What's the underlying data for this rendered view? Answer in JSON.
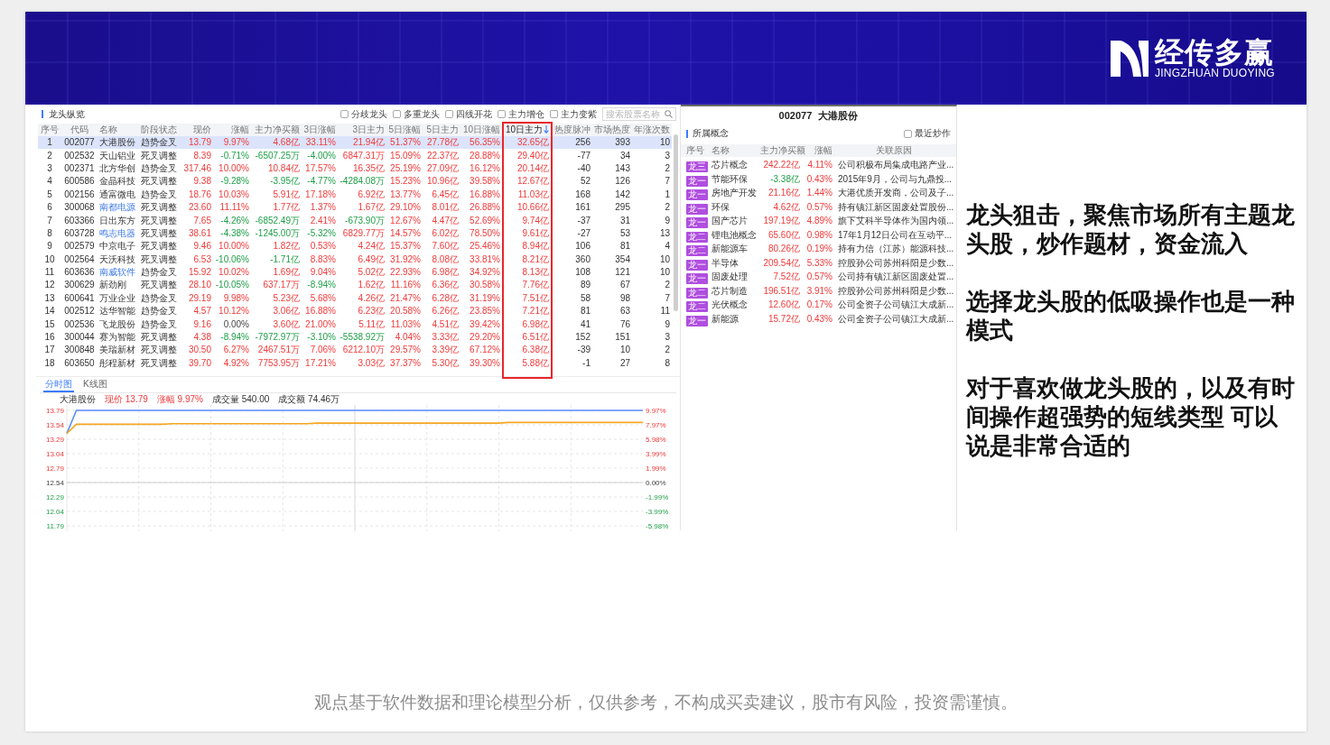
{
  "header": {
    "logo_title": "经传多赢",
    "logo_subtitle": "JINGZHUAN DUOYING"
  },
  "ranking": {
    "title": "龙头纵览",
    "filters": [
      {
        "label": "分歧龙头",
        "checked": false
      },
      {
        "label": "多重龙头",
        "checked": false
      },
      {
        "label": "四线开花",
        "checked": false
      },
      {
        "label": "主力增仓",
        "checked": false
      },
      {
        "label": "主力变紫",
        "checked": false
      }
    ],
    "search": {
      "placeholder": "搜索股票名称"
    },
    "columns": [
      {
        "label": "序号",
        "sorted": false,
        "framed": false
      },
      {
        "label": "代码",
        "sorted": false,
        "framed": false
      },
      {
        "label": "名称",
        "sorted": false,
        "framed": false
      },
      {
        "label": "阶段状态",
        "sorted": false,
        "framed": false
      },
      {
        "label": "现价",
        "sorted": false,
        "framed": false
      },
      {
        "label": "涨幅",
        "sorted": false,
        "framed": false
      },
      {
        "label": "主力净买额",
        "sorted": false,
        "framed": false
      },
      {
        "label": "3日涨幅",
        "sorted": false,
        "framed": false
      },
      {
        "label": "3日主力",
        "sorted": false,
        "framed": false
      },
      {
        "label": "5日涨幅",
        "sorted": false,
        "framed": false
      },
      {
        "label": "5日主力",
        "sorted": false,
        "framed": false
      },
      {
        "label": "10日涨幅",
        "sorted": false,
        "framed": false
      },
      {
        "label": "10日主力",
        "sorted": true,
        "framed": true
      },
      {
        "label": "热度脉冲",
        "sorted": false,
        "framed": false
      },
      {
        "label": "市场热度",
        "sorted": false,
        "framed": false
      },
      {
        "label": "年涨次数",
        "sorted": false,
        "framed": false
      }
    ],
    "rows": [
      {
        "no": "1",
        "code": "002077",
        "name": "大港股份",
        "highlighted": false,
        "stage": "趋势金叉",
        "figures": [
          {
            "text": "13.79",
            "rising": true,
            "falling": false
          },
          {
            "text": "9.97%",
            "rising": true,
            "falling": false
          },
          {
            "text": "4.68亿",
            "rising": true,
            "falling": false
          },
          {
            "text": "33.11%",
            "rising": true,
            "falling": false
          },
          {
            "text": "21.94亿",
            "rising": true,
            "falling": false
          },
          {
            "text": "51.37%",
            "rising": true,
            "falling": false
          },
          {
            "text": "27.78亿",
            "rising": true,
            "falling": false
          },
          {
            "text": "56.35%",
            "rising": true,
            "falling": false
          },
          {
            "text": "32.65亿",
            "rising": true,
            "falling": false
          }
        ],
        "heat_pulse": "256",
        "market_heat": "393",
        "up_count": "10",
        "selected": true
      },
      {
        "no": "2",
        "code": "002532",
        "name": "天山铝业",
        "highlighted": false,
        "stage": "死叉调整",
        "figures": [
          {
            "text": "8.39",
            "rising": true,
            "falling": false
          },
          {
            "text": "-0.71%",
            "rising": false,
            "falling": true
          },
          {
            "text": "-6507.25万",
            "rising": false,
            "falling": true
          },
          {
            "text": "-4.00%",
            "rising": false,
            "falling": true
          },
          {
            "text": "6847.31万",
            "rising": true,
            "falling": false
          },
          {
            "text": "15.09%",
            "rising": true,
            "falling": false
          },
          {
            "text": "22.37亿",
            "rising": true,
            "falling": false
          },
          {
            "text": "28.88%",
            "rising": true,
            "falling": false
          },
          {
            "text": "29.40亿",
            "rising": true,
            "falling": false
          }
        ],
        "heat_pulse": "-77",
        "market_heat": "34",
        "up_count": "3",
        "selected": false
      },
      {
        "no": "3",
        "code": "002371",
        "name": "北方华创",
        "highlighted": false,
        "stage": "趋势金叉",
        "figures": [
          {
            "text": "317.46",
            "rising": true,
            "falling": false
          },
          {
            "text": "10.00%",
            "rising": true,
            "falling": false
          },
          {
            "text": "10.84亿",
            "rising": true,
            "falling": false
          },
          {
            "text": "17.57%",
            "rising": true,
            "falling": false
          },
          {
            "text": "16.35亿",
            "rising": true,
            "falling": false
          },
          {
            "text": "25.19%",
            "rising": true,
            "falling": false
          },
          {
            "text": "27.09亿",
            "rising": true,
            "falling": false
          },
          {
            "text": "16.12%",
            "rising": true,
            "falling": false
          },
          {
            "text": "20.14亿",
            "rising": true,
            "falling": false
          }
        ],
        "heat_pulse": "-40",
        "market_heat": "143",
        "up_count": "2",
        "selected": false
      },
      {
        "no": "4",
        "code": "600586",
        "name": "金晶科技",
        "highlighted": false,
        "stage": "死叉调整",
        "figures": [
          {
            "text": "9.38",
            "rising": true,
            "falling": false
          },
          {
            "text": "-9.28%",
            "rising": false,
            "falling": true
          },
          {
            "text": "-3.95亿",
            "rising": false,
            "falling": true
          },
          {
            "text": "-4.77%",
            "rising": false,
            "falling": true
          },
          {
            "text": "-4284.08万",
            "rising": false,
            "falling": true
          },
          {
            "text": "15.23%",
            "rising": true,
            "falling": false
          },
          {
            "text": "10.96亿",
            "rising": true,
            "falling": false
          },
          {
            "text": "39.58%",
            "rising": true,
            "falling": false
          },
          {
            "text": "12.67亿",
            "rising": true,
            "falling": false
          }
        ],
        "heat_pulse": "52",
        "market_heat": "126",
        "up_count": "7",
        "selected": false
      },
      {
        "no": "5",
        "code": "002156",
        "name": "通富微电",
        "highlighted": false,
        "stage": "趋势金叉",
        "figures": [
          {
            "text": "18.76",
            "rising": true,
            "falling": false
          },
          {
            "text": "10.03%",
            "rising": true,
            "falling": false
          },
          {
            "text": "5.91亿",
            "rising": true,
            "falling": false
          },
          {
            "text": "17.18%",
            "rising": true,
            "falling": false
          },
          {
            "text": "6.92亿",
            "rising": true,
            "falling": false
          },
          {
            "text": "13.77%",
            "rising": true,
            "falling": false
          },
          {
            "text": "6.45亿",
            "rising": true,
            "falling": false
          },
          {
            "text": "16.88%",
            "rising": true,
            "falling": false
          },
          {
            "text": "11.03亿",
            "rising": true,
            "falling": false
          }
        ],
        "heat_pulse": "168",
        "market_heat": "142",
        "up_count": "1",
        "selected": false
      },
      {
        "no": "6",
        "code": "300068",
        "name": "南都电源",
        "highlighted": true,
        "stage": "死叉调整",
        "figures": [
          {
            "text": "23.60",
            "rising": true,
            "falling": false
          },
          {
            "text": "11.11%",
            "rising": true,
            "falling": false
          },
          {
            "text": "1.77亿",
            "rising": true,
            "falling": false
          },
          {
            "text": "1.37%",
            "rising": true,
            "falling": false
          },
          {
            "text": "1.67亿",
            "rising": true,
            "falling": false
          },
          {
            "text": "29.10%",
            "rising": true,
            "falling": false
          },
          {
            "text": "8.01亿",
            "rising": true,
            "falling": false
          },
          {
            "text": "26.88%",
            "rising": true,
            "falling": false
          },
          {
            "text": "10.66亿",
            "rising": true,
            "falling": false
          }
        ],
        "heat_pulse": "161",
        "market_heat": "295",
        "up_count": "2",
        "selected": false
      },
      {
        "no": "7",
        "code": "603366",
        "name": "日出东方",
        "highlighted": false,
        "stage": "死叉调整",
        "figures": [
          {
            "text": "7.65",
            "rising": true,
            "falling": false
          },
          {
            "text": "-4.26%",
            "rising": false,
            "falling": true
          },
          {
            "text": "-6852.49万",
            "rising": false,
            "falling": true
          },
          {
            "text": "2.41%",
            "rising": true,
            "falling": false
          },
          {
            "text": "-673.90万",
            "rising": false,
            "falling": true
          },
          {
            "text": "12.67%",
            "rising": true,
            "falling": false
          },
          {
            "text": "4.47亿",
            "rising": true,
            "falling": false
          },
          {
            "text": "52.69%",
            "rising": true,
            "falling": false
          },
          {
            "text": "9.74亿",
            "rising": true,
            "falling": false
          }
        ],
        "heat_pulse": "-37",
        "market_heat": "31",
        "up_count": "9",
        "selected": false
      },
      {
        "no": "8",
        "code": "603728",
        "name": "鸣志电器",
        "highlighted": true,
        "stage": "死叉调整",
        "figures": [
          {
            "text": "38.61",
            "rising": true,
            "falling": false
          },
          {
            "text": "-4.38%",
            "rising": false,
            "falling": true
          },
          {
            "text": "-1245.00万",
            "rising": false,
            "falling": true
          },
          {
            "text": "-5.32%",
            "rising": false,
            "falling": true
          },
          {
            "text": "6829.77万",
            "rising": true,
            "falling": false
          },
          {
            "text": "14.57%",
            "rising": true,
            "falling": false
          },
          {
            "text": "6.02亿",
            "rising": true,
            "falling": false
          },
          {
            "text": "78.50%",
            "rising": true,
            "falling": false
          },
          {
            "text": "9.61亿",
            "rising": true,
            "falling": false
          }
        ],
        "heat_pulse": "-27",
        "market_heat": "53",
        "up_count": "13",
        "selected": false
      },
      {
        "no": "9",
        "code": "002579",
        "name": "中京电子",
        "highlighted": false,
        "stage": "死叉调整",
        "figures": [
          {
            "text": "9.46",
            "rising": true,
            "falling": false
          },
          {
            "text": "10.00%",
            "rising": true,
            "falling": false
          },
          {
            "text": "1.82亿",
            "rising": true,
            "falling": false
          },
          {
            "text": "0.53%",
            "rising": true,
            "falling": false
          },
          {
            "text": "4.24亿",
            "rising": true,
            "falling": false
          },
          {
            "text": "15.37%",
            "rising": true,
            "falling": false
          },
          {
            "text": "7.60亿",
            "rising": true,
            "falling": false
          },
          {
            "text": "25.46%",
            "rising": true,
            "falling": false
          },
          {
            "text": "8.94亿",
            "rising": true,
            "falling": false
          }
        ],
        "heat_pulse": "106",
        "market_heat": "81",
        "up_count": "4",
        "selected": false
      },
      {
        "no": "10",
        "code": "002564",
        "name": "天沃科技",
        "highlighted": false,
        "stage": "死叉调整",
        "figures": [
          {
            "text": "6.53",
            "rising": true,
            "falling": false
          },
          {
            "text": "-10.06%",
            "rising": false,
            "falling": true
          },
          {
            "text": "-1.71亿",
            "rising": false,
            "falling": true
          },
          {
            "text": "8.83%",
            "rising": true,
            "falling": false
          },
          {
            "text": "6.49亿",
            "rising": true,
            "falling": false
          },
          {
            "text": "31.92%",
            "rising": true,
            "falling": false
          },
          {
            "text": "8.08亿",
            "rising": true,
            "falling": false
          },
          {
            "text": "33.81%",
            "rising": true,
            "falling": false
          },
          {
            "text": "8.21亿",
            "rising": true,
            "falling": false
          }
        ],
        "heat_pulse": "360",
        "market_heat": "354",
        "up_count": "10",
        "selected": false
      },
      {
        "no": "11",
        "code": "603636",
        "name": "南威软件",
        "highlighted": true,
        "stage": "趋势金叉",
        "figures": [
          {
            "text": "15.92",
            "rising": true,
            "falling": false
          },
          {
            "text": "10.02%",
            "rising": true,
            "falling": false
          },
          {
            "text": "1.69亿",
            "rising": true,
            "falling": false
          },
          {
            "text": "9.04%",
            "rising": true,
            "falling": false
          },
          {
            "text": "5.02亿",
            "rising": true,
            "falling": false
          },
          {
            "text": "22.93%",
            "rising": true,
            "falling": false
          },
          {
            "text": "6.98亿",
            "rising": true,
            "falling": false
          },
          {
            "text": "34.92%",
            "rising": true,
            "falling": false
          },
          {
            "text": "8.13亿",
            "rising": true,
            "falling": false
          }
        ],
        "heat_pulse": "108",
        "market_heat": "121",
        "up_count": "10",
        "selected": false
      },
      {
        "no": "12",
        "code": "300629",
        "name": "新劲刚",
        "highlighted": false,
        "stage": "死叉调整",
        "figures": [
          {
            "text": "28.10",
            "rising": true,
            "falling": false
          },
          {
            "text": "-10.05%",
            "rising": false,
            "falling": true
          },
          {
            "text": "637.17万",
            "rising": true,
            "falling": false
          },
          {
            "text": "-8.94%",
            "rising": false,
            "falling": true
          },
          {
            "text": "1.62亿",
            "rising": true,
            "falling": false
          },
          {
            "text": "11.16%",
            "rising": true,
            "falling": false
          },
          {
            "text": "6.36亿",
            "rising": true,
            "falling": false
          },
          {
            "text": "30.58%",
            "rising": true,
            "falling": false
          },
          {
            "text": "7.76亿",
            "rising": true,
            "falling": false
          }
        ],
        "heat_pulse": "89",
        "market_heat": "67",
        "up_count": "2",
        "selected": false
      },
      {
        "no": "13",
        "code": "600641",
        "name": "万业企业",
        "highlighted": false,
        "stage": "趋势金叉",
        "figures": [
          {
            "text": "29.19",
            "rising": true,
            "falling": false
          },
          {
            "text": "9.98%",
            "rising": true,
            "falling": false
          },
          {
            "text": "5.23亿",
            "rising": true,
            "falling": false
          },
          {
            "text": "5.68%",
            "rising": true,
            "falling": false
          },
          {
            "text": "4.26亿",
            "rising": true,
            "falling": false
          },
          {
            "text": "21.47%",
            "rising": true,
            "falling": false
          },
          {
            "text": "6.28亿",
            "rising": true,
            "falling": false
          },
          {
            "text": "31.19%",
            "rising": true,
            "falling": false
          },
          {
            "text": "7.51亿",
            "rising": true,
            "falling": false
          }
        ],
        "heat_pulse": "58",
        "market_heat": "98",
        "up_count": "7",
        "selected": false
      },
      {
        "no": "14",
        "code": "002512",
        "name": "达华智能",
        "highlighted": false,
        "stage": "趋势金叉",
        "figures": [
          {
            "text": "4.57",
            "rising": true,
            "falling": false
          },
          {
            "text": "10.12%",
            "rising": true,
            "falling": false
          },
          {
            "text": "3.06亿",
            "rising": true,
            "falling": false
          },
          {
            "text": "16.88%",
            "rising": true,
            "falling": false
          },
          {
            "text": "6.23亿",
            "rising": true,
            "falling": false
          },
          {
            "text": "20.58%",
            "rising": true,
            "falling": false
          },
          {
            "text": "6.26亿",
            "rising": true,
            "falling": false
          },
          {
            "text": "23.85%",
            "rising": true,
            "falling": false
          },
          {
            "text": "7.21亿",
            "rising": true,
            "falling": false
          }
        ],
        "heat_pulse": "81",
        "market_heat": "63",
        "up_count": "11",
        "selected": false
      },
      {
        "no": "15",
        "code": "002536",
        "name": "飞龙股份",
        "highlighted": false,
        "stage": "趋势金叉",
        "figures": [
          {
            "text": "9.16",
            "rising": true,
            "falling": false
          },
          {
            "text": "0.00%",
            "rising": false,
            "falling": false
          },
          {
            "text": "3.60亿",
            "rising": true,
            "falling": false
          },
          {
            "text": "21.00%",
            "rising": true,
            "falling": false
          },
          {
            "text": "5.11亿",
            "rising": true,
            "falling": false
          },
          {
            "text": "11.03%",
            "rising": true,
            "falling": false
          },
          {
            "text": "4.51亿",
            "rising": true,
            "falling": false
          },
          {
            "text": "39.42%",
            "rising": true,
            "falling": false
          },
          {
            "text": "6.98亿",
            "rising": true,
            "falling": false
          }
        ],
        "heat_pulse": "41",
        "market_heat": "76",
        "up_count": "9",
        "selected": false
      },
      {
        "no": "16",
        "code": "300044",
        "name": "赛为智能",
        "highlighted": false,
        "stage": "死叉调整",
        "figures": [
          {
            "text": "4.38",
            "rising": true,
            "falling": false
          },
          {
            "text": "-8.94%",
            "rising": false,
            "falling": true
          },
          {
            "text": "-7972.97万",
            "rising": false,
            "falling": true
          },
          {
            "text": "-3.10%",
            "rising": false,
            "falling": true
          },
          {
            "text": "-5538.92万",
            "rising": false,
            "falling": true
          },
          {
            "text": "4.04%",
            "rising": true,
            "falling": false
          },
          {
            "text": "3.33亿",
            "rising": true,
            "falling": false
          },
          {
            "text": "29.20%",
            "rising": true,
            "falling": false
          },
          {
            "text": "6.51亿",
            "rising": true,
            "falling": false
          }
        ],
        "heat_pulse": "152",
        "market_heat": "151",
        "up_count": "3",
        "selected": false
      },
      {
        "no": "17",
        "code": "300848",
        "name": "美瑞新材",
        "highlighted": false,
        "stage": "死叉调整",
        "figures": [
          {
            "text": "30.50",
            "rising": true,
            "falling": false
          },
          {
            "text": "6.27%",
            "rising": true,
            "falling": false
          },
          {
            "text": "2467.51万",
            "rising": true,
            "falling": false
          },
          {
            "text": "7.06%",
            "rising": true,
            "falling": false
          },
          {
            "text": "6212.10万",
            "rising": true,
            "falling": false
          },
          {
            "text": "29.57%",
            "rising": true,
            "falling": false
          },
          {
            "text": "3.39亿",
            "rising": true,
            "falling": false
          },
          {
            "text": "67.12%",
            "rising": true,
            "falling": false
          },
          {
            "text": "6.38亿",
            "rising": true,
            "falling": false
          }
        ],
        "heat_pulse": "-39",
        "market_heat": "10",
        "up_count": "2",
        "selected": false
      },
      {
        "no": "18",
        "code": "603650",
        "name": "彤程新材",
        "highlighted": false,
        "stage": "死叉调整",
        "figures": [
          {
            "text": "39.70",
            "rising": true,
            "falling": false
          },
          {
            "text": "4.92%",
            "rising": true,
            "falling": false
          },
          {
            "text": "7753.95万",
            "rising": true,
            "falling": false
          },
          {
            "text": "17.21%",
            "rising": true,
            "falling": false
          },
          {
            "text": "3.03亿",
            "rising": true,
            "falling": false
          },
          {
            "text": "37.37%",
            "rising": true,
            "falling": false
          },
          {
            "text": "5.30亿",
            "rising": true,
            "falling": false
          },
          {
            "text": "39.30%",
            "rising": true,
            "falling": false
          },
          {
            "text": "5.88亿",
            "rising": true,
            "falling": false
          }
        ],
        "heat_pulse": "-1",
        "market_heat": "27",
        "up_count": "8",
        "selected": false
      }
    ]
  },
  "chart_panel": {
    "tabs": [
      {
        "label": "分时图",
        "selected": true
      },
      {
        "label": "K线图",
        "selected": false
      }
    ],
    "legend": [
      {
        "text": "大港股份",
        "rising": false
      },
      {
        "text": "现价 13.79",
        "rising": true
      },
      {
        "text": "涨幅 9.97%",
        "rising": true
      },
      {
        "text": "成交量 540.00",
        "rising": false
      },
      {
        "text": "成交额 74.46万",
        "rising": false
      }
    ],
    "right_labels": [
      "9.97%",
      "7.97%",
      "5.98%",
      "3.99%",
      "1.99%",
      "0.00%",
      "-1.99%",
      "-3.99%",
      "-5.98%"
    ],
    "chart_data": {
      "type": "line",
      "grid": true,
      "categories": [
        null,
        null,
        null,
        null,
        null,
        null,
        null,
        null,
        null,
        null,
        null,
        null,
        null,
        null,
        null,
        null,
        null,
        null,
        null,
        null,
        null,
        null,
        null,
        null,
        null,
        null,
        null,
        null,
        null,
        null,
        null,
        null,
        null,
        null,
        null,
        null,
        null,
        null,
        null,
        null,
        null,
        null,
        null,
        null,
        null,
        null,
        null,
        null,
        null,
        null,
        null,
        null,
        null,
        null,
        null,
        null,
        null,
        null,
        null,
        null,
        null
      ],
      "ylim": [
        11.79,
        13.79
      ],
      "yticks": [
        {
          "value": 13.79,
          "label": "13.79"
        },
        {
          "value": 13.54,
          "label": "13.54"
        },
        {
          "value": 13.29,
          "label": "13.29"
        },
        {
          "value": 13.04,
          "label": "13.04"
        },
        {
          "value": 12.79,
          "label": "12.79"
        },
        {
          "value": 12.54,
          "label": "12.54"
        },
        {
          "value": 12.29,
          "label": "12.29"
        },
        {
          "value": 12.04,
          "label": "12.04"
        },
        {
          "value": 11.79,
          "label": "11.79"
        }
      ],
      "series": [
        {
          "color": "#5b8ff9",
          "values": [
            13.39,
            13.79,
            13.79,
            13.79,
            13.79,
            13.79,
            13.79,
            13.79,
            13.79,
            13.79,
            13.79,
            13.79,
            13.79,
            13.79,
            13.79,
            13.79,
            13.79,
            13.79,
            13.79,
            13.79,
            13.79,
            13.79,
            13.79,
            13.79,
            13.79,
            13.79,
            13.79,
            13.79,
            13.79,
            13.79,
            13.79,
            13.79,
            13.79,
            13.79,
            13.79,
            13.79,
            13.79,
            13.79,
            13.79,
            13.79,
            13.79,
            13.79,
            13.79,
            13.79,
            13.79,
            13.79,
            13.79,
            13.79,
            13.79,
            13.79,
            13.79,
            13.79,
            13.79,
            13.79,
            13.79,
            13.79,
            13.79,
            13.79,
            13.79,
            13.79,
            13.79
          ]
        },
        {
          "color": "#f5a623",
          "values": [
            13.39,
            13.55,
            13.55,
            13.55,
            13.55,
            13.55,
            13.55,
            13.55,
            13.55,
            13.55,
            13.55,
            13.56,
            13.56,
            13.56,
            13.56,
            13.56,
            13.56,
            13.56,
            13.56,
            13.56,
            13.56,
            13.56,
            13.56,
            13.56,
            13.56,
            13.56,
            13.57,
            13.57,
            13.57,
            13.57,
            13.57,
            13.57,
            13.57,
            13.57,
            13.57,
            13.57,
            13.57,
            13.57,
            13.57,
            13.57,
            13.57,
            13.57,
            13.57,
            13.57,
            13.57,
            13.57,
            13.58,
            13.58,
            13.58,
            13.58,
            13.58,
            13.58,
            13.58,
            13.58,
            13.58,
            13.58,
            13.58,
            13.58,
            13.58,
            13.58,
            13.58
          ]
        }
      ],
      "ref_lines": [
        {
          "axis": "y",
          "value": 12.54
        }
      ]
    }
  },
  "stock_detail": {
    "title": "002077 大港股份",
    "section": "所属概念",
    "filter": {
      "label": "最近炒作",
      "checked": false
    },
    "columns": [
      "序号",
      "名称",
      "主力净买额",
      "涨幅",
      "关联原因"
    ],
    "rows": [
      {
        "badge": "龙三",
        "name": "芯片概念",
        "net_buy": {
          "text": "242.22亿",
          "rising": true,
          "falling": false
        },
        "change": {
          "text": "4.11%",
          "rising": true,
          "falling": false
        },
        "reason": "公司积极布局集成电路产业..."
      },
      {
        "badge": "龙一",
        "name": "节能环保",
        "net_buy": {
          "text": "-3.38亿",
          "rising": false,
          "falling": true
        },
        "change": {
          "text": "0.43%",
          "rising": true,
          "falling": false
        },
        "reason": "2015年9月，公司与九鼎投..."
      },
      {
        "badge": "龙一",
        "name": "房地产开发",
        "net_buy": {
          "text": "21.16亿",
          "rising": true,
          "falling": false
        },
        "change": {
          "text": "1.44%",
          "rising": true,
          "falling": false
        },
        "reason": "大港优质开发商，公司及子..."
      },
      {
        "badge": "龙一",
        "name": "环保",
        "net_buy": {
          "text": "4.62亿",
          "rising": true,
          "falling": false
        },
        "change": {
          "text": "0.57%",
          "rising": true,
          "falling": false
        },
        "reason": "持有镇江新区固废处置股份..."
      },
      {
        "badge": "龙一",
        "name": "国产芯片",
        "net_buy": {
          "text": "197.19亿",
          "rising": true,
          "falling": false
        },
        "change": {
          "text": "4.89%",
          "rising": true,
          "falling": false
        },
        "reason": "旗下艾科半导体作为国内领..."
      },
      {
        "badge": "龙二",
        "name": "锂电池概念",
        "net_buy": {
          "text": "65.60亿",
          "rising": true,
          "falling": false
        },
        "change": {
          "text": "0.98%",
          "rising": true,
          "falling": false
        },
        "reason": "17年1月12日公司在互动平..."
      },
      {
        "badge": "龙二",
        "name": "新能源车",
        "net_buy": {
          "text": "80.26亿",
          "rising": true,
          "falling": false
        },
        "change": {
          "text": "0.19%",
          "rising": true,
          "falling": false
        },
        "reason": "持有力信（江苏）能源科技..."
      },
      {
        "badge": "龙一",
        "name": "半导体",
        "net_buy": {
          "text": "209.54亿",
          "rising": true,
          "falling": false
        },
        "change": {
          "text": "5.33%",
          "rising": true,
          "falling": false
        },
        "reason": "控股孙公司苏州科阳是少数..."
      },
      {
        "badge": "龙一",
        "name": "固废处理",
        "net_buy": {
          "text": "7.52亿",
          "rising": true,
          "falling": false
        },
        "change": {
          "text": "0.57%",
          "rising": true,
          "falling": false
        },
        "reason": "公司持有镇江新区固废处置..."
      },
      {
        "badge": "龙二",
        "name": "芯片制造",
        "net_buy": {
          "text": "196.51亿",
          "rising": true,
          "falling": false
        },
        "change": {
          "text": "3.91%",
          "rising": true,
          "falling": false
        },
        "reason": "控股孙公司苏州科阳是少数..."
      },
      {
        "badge": "龙二",
        "name": "光伏概念",
        "net_buy": {
          "text": "12.60亿",
          "rising": true,
          "falling": false
        },
        "change": {
          "text": "0.17%",
          "rising": true,
          "falling": false
        },
        "reason": "公司全资子公司镇江大成新..."
      },
      {
        "badge": "龙一",
        "name": "新能源",
        "net_buy": {
          "text": "15.72亿",
          "rising": true,
          "falling": false
        },
        "change": {
          "text": "0.43%",
          "rising": true,
          "falling": false
        },
        "reason": "公司全资子公司镇江大成新..."
      }
    ]
  },
  "notes": [
    "龙头狙击，聚焦市场所有主题龙头股，炒作题材，资金流入",
    "选择龙头股的低吸操作也是一种模式",
    "对于喜欢做龙头股的，以及有时间操作超强势的短线类型 可以说是非常合适的"
  ],
  "disclaimer": "观点基于软件数据和理论模型分析，仅供参考，不构成买卖建议，股市有风险，投资需谨慎。"
}
